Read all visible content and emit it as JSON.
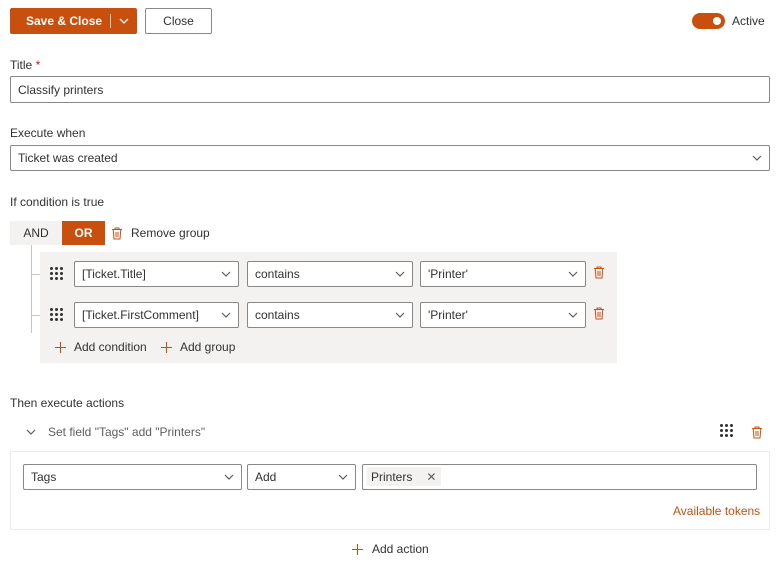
{
  "toolbar": {
    "save_close_label": "Save & Close",
    "close_label": "Close",
    "active_label": "Active",
    "active": true
  },
  "title_field": {
    "label": "Title",
    "required_marker": "*",
    "value": "Classify printers"
  },
  "execute_when": {
    "label": "Execute when",
    "value": "Ticket was created"
  },
  "conditions": {
    "label": "If condition is true",
    "and_label": "AND",
    "or_label": "OR",
    "selected_operator": "OR",
    "remove_group_label": "Remove group",
    "rows": [
      {
        "field": "[Ticket.Title]",
        "operator": "contains",
        "value": "'Printer'"
      },
      {
        "field": "[Ticket.FirstComment]",
        "operator": "contains",
        "value": "'Printer'"
      }
    ],
    "add_condition_label": "Add condition",
    "add_group_label": "Add group"
  },
  "actions": {
    "label": "Then execute actions",
    "items": [
      {
        "summary": "Set field \"Tags\" add \"Printers\"",
        "field": "Tags",
        "operation": "Add",
        "chip": "Printers",
        "chip_remove": "✕"
      }
    ],
    "available_tokens_label": "Available tokens",
    "add_action_label": "Add action"
  },
  "colors": {
    "accent": "#c94f0f",
    "danger": "#a4262c",
    "neutral_bg": "#f3f2f1"
  }
}
